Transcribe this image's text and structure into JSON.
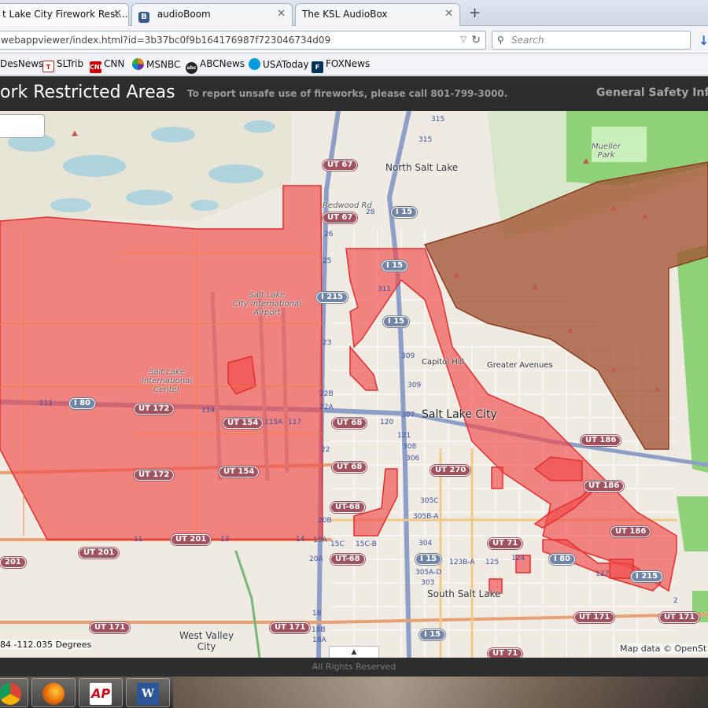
{
  "browser": {
    "tabs": [
      {
        "title": "t Lake City Firework Rest...",
        "icon": "page-icon",
        "active": true
      },
      {
        "title": "audioBoom",
        "icon": "b-icon",
        "active": false
      },
      {
        "title": "The KSL AudioBox",
        "icon": "page-icon",
        "active": false
      }
    ],
    "new_tab_label": "+",
    "url": "webappviewer/index.html?id=3b37bc0f9b164176987f723046734d09",
    "search_placeholder": "Search",
    "bookmarks": [
      {
        "label": "DesNews",
        "icon": "desnews-icon",
        "color": "#1a4a8a"
      },
      {
        "label": "SLTrib",
        "icon": "sltrib-icon",
        "color": "#b02020"
      },
      {
        "label": "CNN",
        "icon": "cnn-icon",
        "color": "#cc0000"
      },
      {
        "label": "MSNBC",
        "icon": "msnbc-icon",
        "color": "#e77d21"
      },
      {
        "label": "ABCNews",
        "icon": "abc-icon",
        "color": "#222222"
      },
      {
        "label": "USAToday",
        "icon": "usatoday-icon",
        "color": "#009bde"
      },
      {
        "label": "FOXNews",
        "icon": "foxnews-icon",
        "color": "#00315b"
      }
    ]
  },
  "app": {
    "title": "ork Restricted Areas",
    "note": "To report unsafe use of fireworks, please call 801-799-3000.",
    "safety_link": "General Safety Infor"
  },
  "map": {
    "places": {
      "north_salt_lake": "North Salt Lake",
      "salt_lake_city": "Salt Lake City",
      "capitol_hill": "Capitol Hill",
      "greater_avenues": "Greater Avenues",
      "south_salt_lake": "South Salt Lake",
      "west_valley_city": "West Valley\nCity",
      "mueller_park": "Mueller\nPark",
      "slc_airport": "Salt Lake\nCity International\nAirport",
      "slc_intl_center": "Salt Lake\nInternational\nCenter",
      "redwood_rd": "Redwood Rd"
    },
    "roads": {
      "ut67_a": "UT 67",
      "ut67_b": "UT 67",
      "i15_a": "I 15",
      "i15_b": "I 15",
      "i15_c": "I 15",
      "i15_d": "I 15",
      "i15_e": "I 15",
      "i215_a": "I 215",
      "i215_b": "I 215",
      "i80_a": "I 80",
      "i80_b": "I 80",
      "ut172_a": "UT 172",
      "ut172_b": "UT 172",
      "ut154_a": "UT 154",
      "ut154_b": "UT 154",
      "ut68_a": "UT 68",
      "ut68_b": "UT 68",
      "ut68_c": "UT-68",
      "ut68_d": "UT-68",
      "ut270": "UT 270",
      "ut201_a": "UT 201",
      "ut201_b": "UT 201",
      "ut201_c": "201",
      "ut171_a": "UT 171",
      "ut171_b": "UT 171",
      "ut171_c": "UT 171",
      "ut171_d": "UT 171",
      "ut171_e": "UT 71",
      "ut171_f": "UT 71",
      "ut186_a": "UT 186",
      "ut186_b": "UT 186",
      "ut186_c": "UT 186",
      "r111": "111",
      "r315a": "315",
      "r315b": "315"
    },
    "exits": [
      "28",
      "26",
      "25",
      "311",
      "23",
      "22B",
      "22A",
      "22",
      "309",
      "309",
      "307",
      "120",
      "121",
      "308",
      "306",
      "305C",
      "305B-A",
      "304",
      "305A-D",
      "303",
      "123B-A",
      "125",
      "124",
      "127",
      "114",
      "115A",
      "117",
      "20B",
      "20A",
      "19A",
      "18",
      "18B",
      "18A",
      "15C",
      "15C-B",
      "14",
      "13",
      "11",
      "2"
    ],
    "coordinates": "84 -112.035 Degrees",
    "attribution": "Map data © OpenSt",
    "toggle_icon": "▲"
  },
  "footer": {
    "text": "All Rights Reserved"
  },
  "taskbar": {
    "apps": [
      {
        "name": "chrome-icon",
        "label": ""
      },
      {
        "name": "firefox-icon",
        "label": ""
      },
      {
        "name": "ap-icon",
        "label": "AP"
      },
      {
        "name": "word-icon",
        "label": "W"
      }
    ]
  },
  "colors": {
    "restricted_fill": "#f04a4a",
    "restricted_stroke": "#e03030",
    "header_bg": "#2d2d2d",
    "park_green": "#8fd27a"
  }
}
